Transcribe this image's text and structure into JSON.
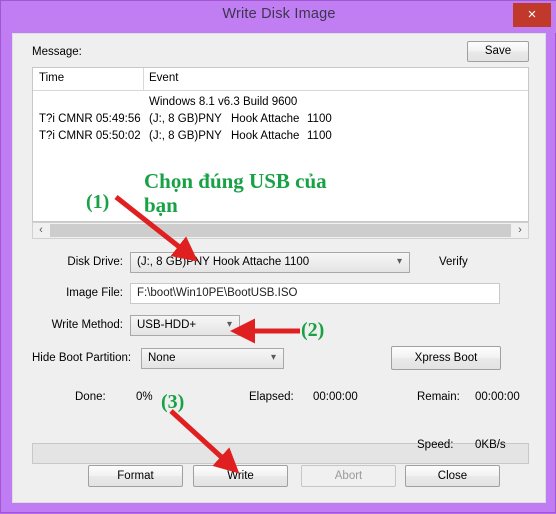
{
  "window": {
    "title": "Write Disk Image",
    "close_label": "×"
  },
  "message": {
    "label": "Message:",
    "save_label": "Save",
    "columns": [
      "Time",
      "Event"
    ],
    "rows": [
      {
        "time": "",
        "device": "Windows 8.1 v6.3 Build 9600",
        "model": "",
        "code": ""
      },
      {
        "time": "T?i CMNR 05:49:56",
        "device": "(J:, 8 GB)PNY",
        "model": "Hook Attache",
        "code": "1100"
      },
      {
        "time": "T?i CMNR 05:50:02",
        "device": "(J:, 8 GB)PNY",
        "model": "Hook Attache",
        "code": "1100"
      }
    ],
    "scroll_left": "‹",
    "scroll_right": "›"
  },
  "fields": {
    "disk_drive_label": "Disk Drive:",
    "disk_drive_value": "(J:, 8 GB)PNY    Hook Attache    1100",
    "verify_label": "Verify",
    "image_file_label": "Image File:",
    "image_file_value": "F:\\boot\\Win10PE\\BootUSB.ISO",
    "write_method_label": "Write Method:",
    "write_method_value": "USB-HDD+",
    "hide_boot_label": "Hide Boot Partition:",
    "hide_boot_value": "None",
    "xpress_boot_label": "Xpress Boot",
    "chevron": "⌵"
  },
  "status": {
    "done_label": "Done:",
    "done_value": "0%",
    "elapsed_label": "Elapsed:",
    "elapsed_value": "00:00:00",
    "remain_label": "Remain:",
    "remain_value": "00:00:00",
    "speed_label": "Speed:",
    "speed_value": "0KB/s"
  },
  "buttons": {
    "format": "Format",
    "write": "Write",
    "abort": "Abort",
    "close": "Close"
  },
  "annotations": {
    "note": "Chọn đúng USB của bạn",
    "step1": "(1)",
    "step2": "(2)",
    "step3": "(3)",
    "color": "#19a145",
    "arrow_color": "#e02020"
  },
  "colors": {
    "titlebar": "#c17ef3",
    "close_button": "#c0392b",
    "client": "#efefef"
  }
}
